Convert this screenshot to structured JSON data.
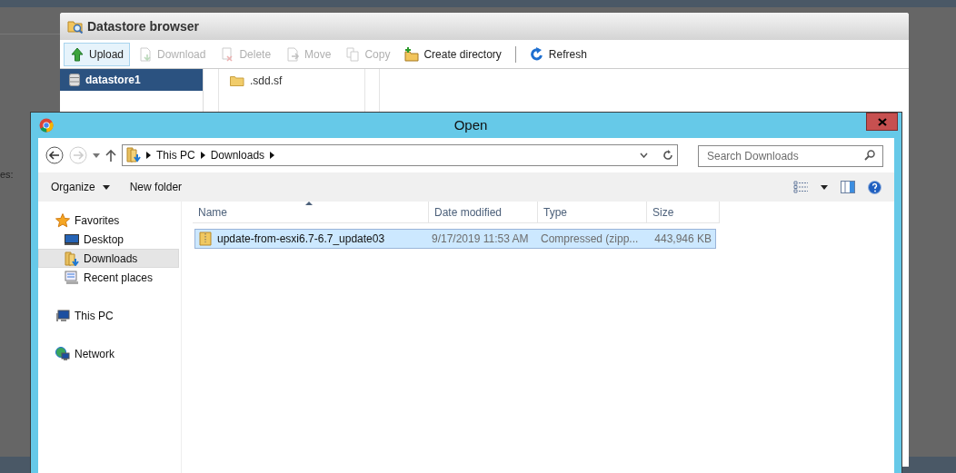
{
  "background_text": "es:",
  "datastore_browser": {
    "title": "Datastore browser",
    "toolbar": [
      {
        "label": "Upload",
        "disabled": false,
        "highlighted": true
      },
      {
        "label": "Download",
        "disabled": true,
        "highlighted": false
      },
      {
        "label": "Delete",
        "disabled": true,
        "highlighted": false
      },
      {
        "label": "Move",
        "disabled": true,
        "highlighted": false
      },
      {
        "label": "Copy",
        "disabled": true,
        "highlighted": false
      },
      {
        "label": "Create directory",
        "disabled": false,
        "highlighted": false
      },
      {
        "label": "Refresh",
        "disabled": false,
        "highlighted": false
      }
    ],
    "datastores": [
      {
        "label": "datastore1",
        "selected": true
      }
    ],
    "files": [
      {
        "name": ".sdd.sf"
      }
    ]
  },
  "open_dialog": {
    "title": "Open",
    "breadcrumb": [
      "This PC",
      "Downloads"
    ],
    "search": {
      "placeholder": "Search Downloads"
    },
    "toolbar": [
      "Organize",
      "New folder"
    ],
    "nav": [
      {
        "label": "Favorites",
        "selected": false,
        "children": [
          {
            "label": "Desktop",
            "selected": false
          },
          {
            "label": "Downloads",
            "selected": true
          },
          {
            "label": "Recent places",
            "selected": false
          }
        ]
      },
      {
        "label": "This PC",
        "selected": false
      },
      {
        "label": "Network",
        "selected": false
      }
    ],
    "columns": [
      "Name",
      "Date modified",
      "Type",
      "Size"
    ],
    "rows": [
      {
        "cells": [
          "update-from-esxi6.7-6.7_update03",
          "9/17/2019 11:53 AM",
          "Compressed (zipp...",
          "443,946 KB"
        ],
        "selected": true
      }
    ]
  }
}
